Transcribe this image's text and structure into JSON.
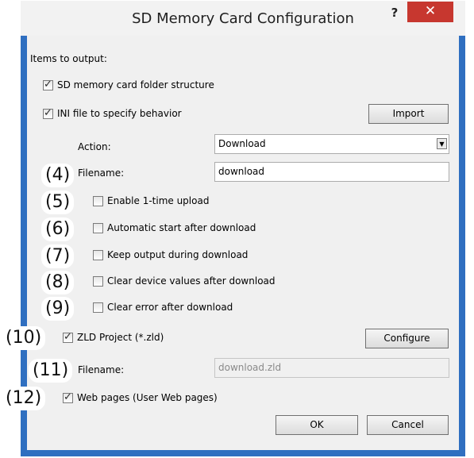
{
  "window": {
    "title": "SD Memory Card Configuration",
    "help_glyph": "?",
    "close_glyph": "✕"
  },
  "section_label": "Items to output:",
  "items": {
    "sd_folder": {
      "label": "SD memory card folder structure",
      "checked": true
    },
    "ini_file": {
      "label": "INI file to specify behavior",
      "checked": true
    },
    "import_button": "Import",
    "action_label": "Action:",
    "action_value": "Download",
    "filename_label": "Filename:",
    "filename_value": "download",
    "enable_upload": {
      "label": "Enable 1-time upload",
      "checked": false
    },
    "auto_start": {
      "label": "Automatic start after download",
      "checked": false
    },
    "keep_output": {
      "label": "Keep output during download",
      "checked": false
    },
    "clear_device": {
      "label": "Clear device values after download",
      "checked": false
    },
    "clear_error": {
      "label": "Clear error after download",
      "checked": false
    },
    "zld_project": {
      "label": "ZLD Project (*.zld)",
      "checked": true
    },
    "configure_button": "Configure",
    "zld_filename_label": "Filename:",
    "zld_filename_value": "download.zld",
    "web_pages": {
      "label": "Web pages (User Web pages)",
      "checked": true
    }
  },
  "footer": {
    "ok": "OK",
    "cancel": "Cancel"
  },
  "callouts": [
    "(4)",
    "(5)",
    "(6)",
    "(7)",
    "(8)",
    "(9)",
    "(10)",
    "(11)",
    "(12)"
  ],
  "colors": {
    "frame": "#2f6fc0",
    "close_button": "#c7372f",
    "client": "#f0f0f0"
  }
}
